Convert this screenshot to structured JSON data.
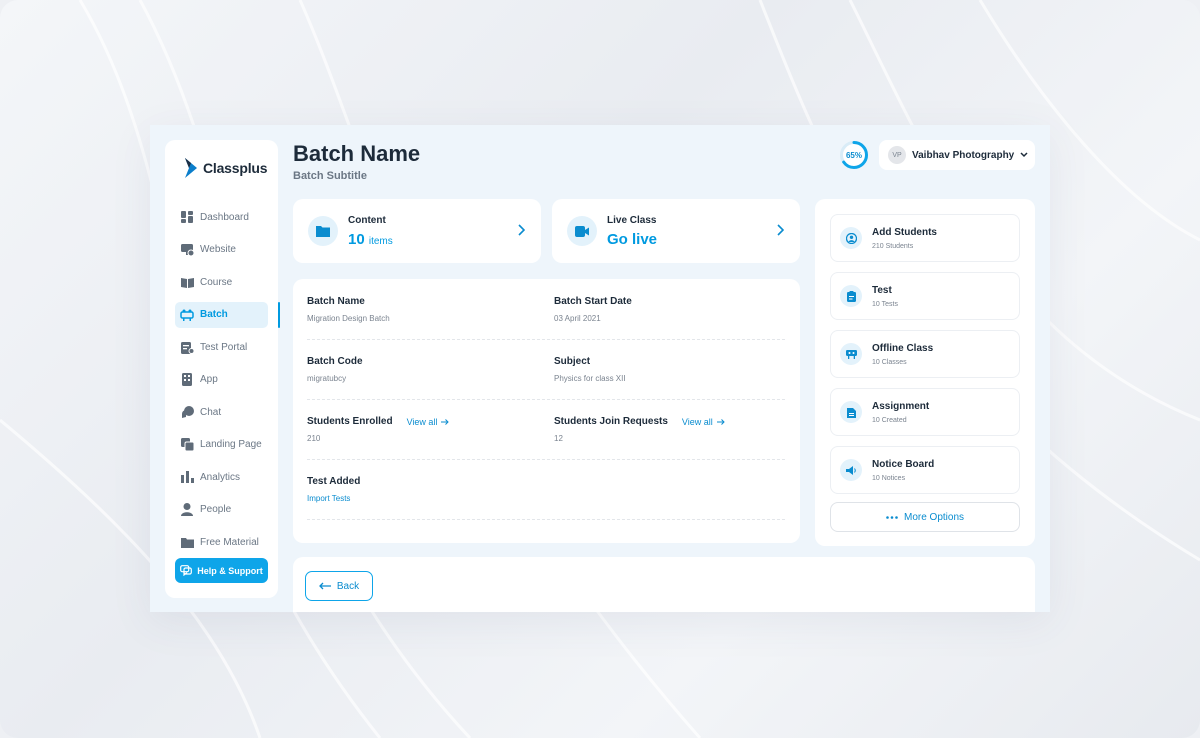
{
  "brand": {
    "name": "Classplus",
    "accent": "#009ae0"
  },
  "sidebar": {
    "items": [
      {
        "label": "Dashboard",
        "icon": "dashboard-icon"
      },
      {
        "label": "Website",
        "icon": "website-icon"
      },
      {
        "label": "Course",
        "icon": "course-icon"
      },
      {
        "label": "Batch",
        "icon": "batch-icon",
        "active": true
      },
      {
        "label": "Test Portal",
        "icon": "test-portal-icon"
      },
      {
        "label": "App",
        "icon": "app-icon"
      },
      {
        "label": "Chat",
        "icon": "chat-icon"
      },
      {
        "label": "Landing Page",
        "icon": "landing-page-icon"
      },
      {
        "label": "Analytics",
        "icon": "analytics-icon"
      },
      {
        "label": "People",
        "icon": "people-icon"
      },
      {
        "label": "Free Material",
        "icon": "free-material-icon"
      }
    ],
    "help_label": "Help & Support"
  },
  "header": {
    "title": "Batch Name",
    "subtitle": "Batch Subtitle",
    "progress_text": "65%",
    "progress_value": 0.65,
    "user_initials": "VP",
    "user_name": "Vaibhav Photography"
  },
  "cards": {
    "content": {
      "label": "Content",
      "value": "10",
      "unit": "items"
    },
    "live": {
      "label": "Live Class",
      "value": "Go live"
    }
  },
  "details": {
    "batch_name_label": "Batch Name",
    "batch_name_value": "Migration Design Batch",
    "start_date_label": "Batch Start Date",
    "start_date_value": "03 April 2021",
    "batch_code_label": "Batch Code",
    "batch_code_value": "migratubcy",
    "subject_label": "Subject",
    "subject_value": "Physics for class XII",
    "enrolled_label": "Students Enrolled",
    "enrolled_value": "210",
    "join_label": "Students Join Requests",
    "join_value": "12",
    "view_all": "View all",
    "test_label": "Test Added",
    "test_value": "Import Tests"
  },
  "options": [
    {
      "title": "Add Students",
      "sub": "210 Students",
      "icon": "add-students-icon"
    },
    {
      "title": "Test",
      "sub": "10 Tests",
      "icon": "test-icon"
    },
    {
      "title": "Offline Class",
      "sub": "10 Classes",
      "icon": "offline-class-icon"
    },
    {
      "title": "Assignment",
      "sub": "10 Created",
      "icon": "assignment-icon"
    },
    {
      "title": "Notice Board",
      "sub": "10 Notices",
      "icon": "notice-board-icon"
    }
  ],
  "more_options": "More Options",
  "back_label": "Back"
}
